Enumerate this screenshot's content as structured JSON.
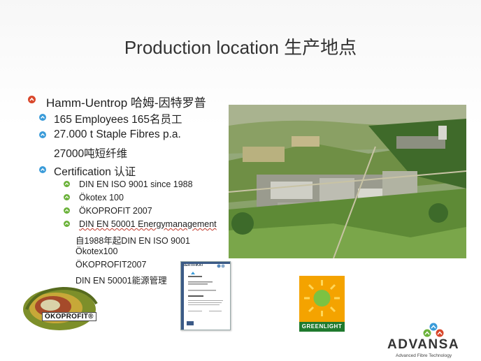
{
  "title": "Production location 生产地点",
  "bullets": {
    "level1": "Hamm-Uentrop 哈姆-因特罗普",
    "level2": {
      "employees": "165 Employees  165名员工",
      "fibres_en": "27.000 t Staple Fibres p.a.",
      "fibres_cn": "27000吨短纤维",
      "certification": "Certification 认证"
    },
    "level3": [
      "DIN EN ISO 9001 since 1988",
      "Ökotex 100",
      "ÖKOPROFIT 2007",
      "DIN EN 50001 Energymanagement"
    ],
    "chinese_lines": [
      "自1988年起DIN  EN ISO 9001",
      "Ökotex100",
      "ÖKOPROFIT2007",
      "DIN EN 50001能源管理"
    ]
  },
  "logos": {
    "oekoprofit": "ÖKOPROFIT®",
    "greenlight": "GREENLIGHT",
    "certificate_heading": "ZERTIFIKAT",
    "advansa_name": "ADVANSA",
    "advansa_tagline": "Advanced Fibre Technology"
  },
  "colors": {
    "level1_bullet": "#d9472b",
    "level2_bullet": "#3a9bd9",
    "level3_bullet": "#6bb23a",
    "greenlight_bg": "#f4a300",
    "greenlight_label_bg": "#1f7a2e"
  }
}
